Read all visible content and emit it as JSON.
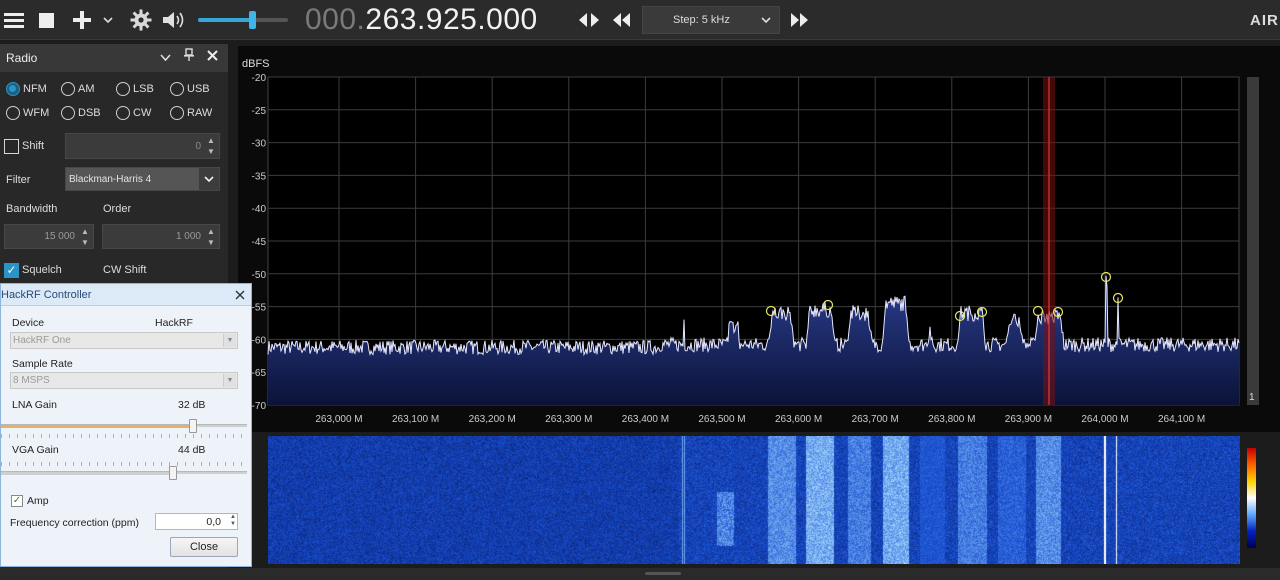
{
  "toolbar": {
    "frequency_dim": "000.",
    "frequency_bright": "263.925.000",
    "step_label": "Step: 5 kHz",
    "brand": "AIR",
    "volume_fraction": 0.6
  },
  "radio_panel": {
    "title": "Radio",
    "modes": [
      {
        "label": "NFM",
        "selected": true
      },
      {
        "label": "AM",
        "selected": false
      },
      {
        "label": "LSB",
        "selected": false
      },
      {
        "label": "USB",
        "selected": false
      },
      {
        "label": "WFM",
        "selected": false
      },
      {
        "label": "DSB",
        "selected": false
      },
      {
        "label": "CW",
        "selected": false
      },
      {
        "label": "RAW",
        "selected": false
      }
    ],
    "shift_label": "Shift",
    "shift_value": "0",
    "filter_label": "Filter",
    "filter_value": "Blackman-Harris 4",
    "bandwidth_label": "Bandwidth",
    "bandwidth_value": "15 000",
    "order_label": "Order",
    "order_value": "1 000",
    "squelch_label": "Squelch",
    "cwshift_label": "CW Shift"
  },
  "spectrum": {
    "unit_label": "dBFS",
    "db_ticks": [
      "-20",
      "-25",
      "-30",
      "-35",
      "-40",
      "-45",
      "-50",
      "-55",
      "-60",
      "-65",
      "-70"
    ],
    "freq_ticks": [
      "263,000 M",
      "263,100 M",
      "263,200 M",
      "263,300 M",
      "263,400 M",
      "263,500 M",
      "263,600 M",
      "263,700 M",
      "263,800 M",
      "263,900 M",
      "264,000 M",
      "264,100 M"
    ],
    "scroll_value": "1"
  },
  "dialog": {
    "title": "HackRF Controller",
    "device_label": "Device",
    "device_name": "HackRF",
    "device_value": "HackRF One",
    "sample_rate_label": "Sample Rate",
    "sample_rate_value": "8 MSPS",
    "lna_label": "LNA Gain",
    "lna_value": "32 dB",
    "lna_fraction": 0.78,
    "vga_label": "VGA Gain",
    "vga_value": "44 dB",
    "vga_fraction": 0.7,
    "amp_label": "Amp",
    "freq_corr_label": "Frequency correction (ppm)",
    "freq_corr_value": "0,0",
    "close_label": "Close"
  },
  "colors": {
    "accent": "#2a93c7",
    "trace": "#e8e8ff",
    "fill": "#1e2d6e",
    "grid": "#3c3c3c",
    "marker": "#e8e860"
  }
}
